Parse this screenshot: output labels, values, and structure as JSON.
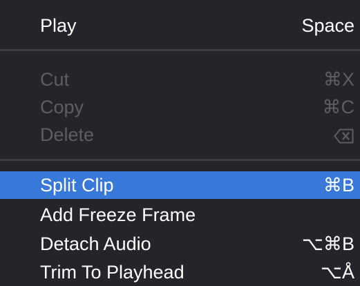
{
  "colors": {
    "background": "#24242a",
    "text": "#ffffff",
    "disabled_text": "#5d5e63",
    "highlight": "#3778d8",
    "separator": "#3d3e43"
  },
  "menu": {
    "play": {
      "label": "Play",
      "shortcut": "Space"
    },
    "cut": {
      "label": "Cut",
      "shortcut": "⌘X"
    },
    "copy": {
      "label": "Copy",
      "shortcut": "⌘C"
    },
    "delete": {
      "label": "Delete",
      "shortcut_icon": "delete-key-icon"
    },
    "split_clip": {
      "label": "Split Clip",
      "shortcut": "⌘B"
    },
    "add_freeze_frame": {
      "label": "Add Freeze Frame",
      "shortcut": ""
    },
    "detach_audio": {
      "label": "Detach Audio",
      "shortcut": "⌥⌘B"
    },
    "trim_to_playhead": {
      "label": "Trim To Playhead",
      "shortcut": "⌥Å"
    }
  }
}
